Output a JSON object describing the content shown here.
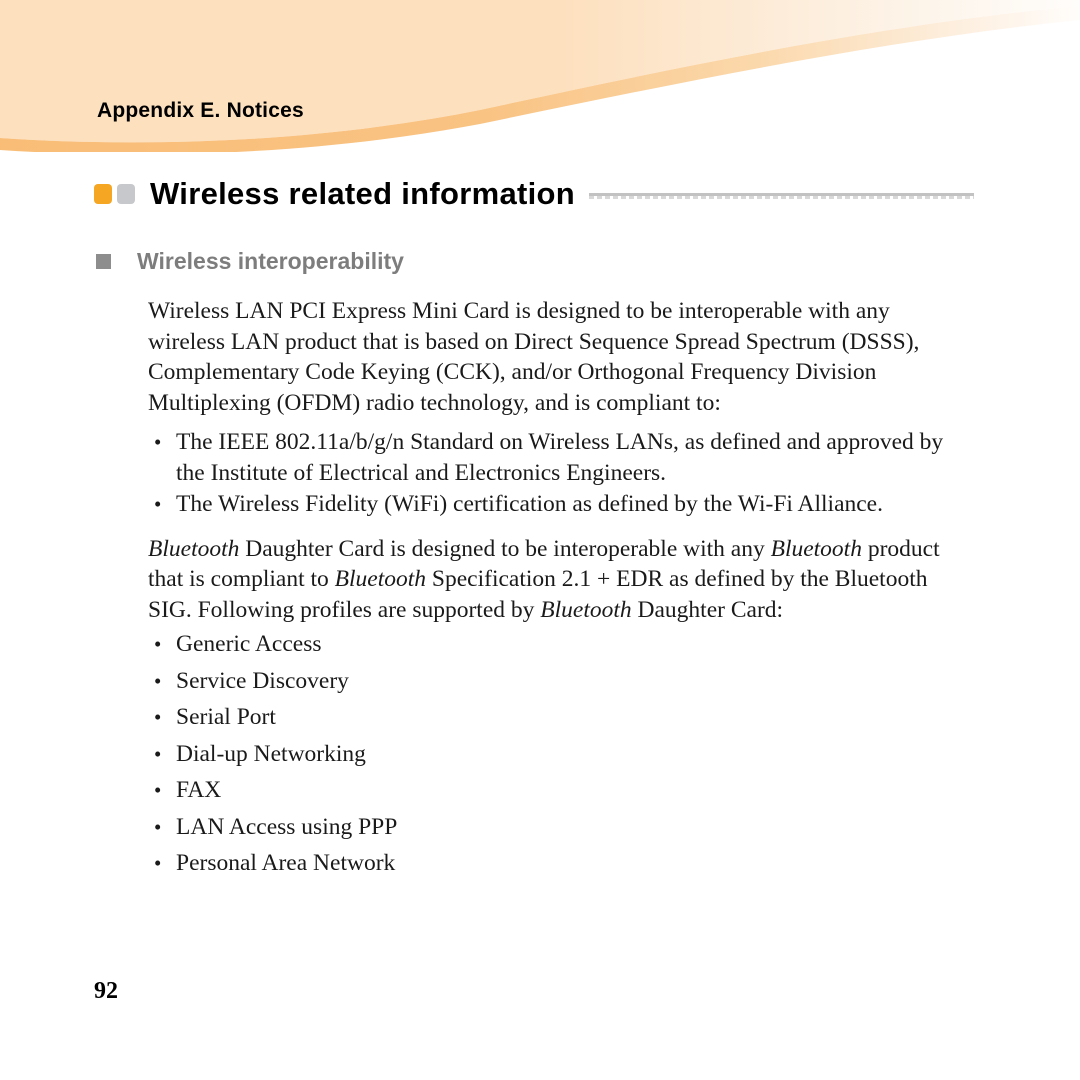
{
  "header": {
    "title": "Appendix E. Notices",
    "band_color_top": "#fde0be",
    "band_color_stripe": "#f9bd77"
  },
  "heading": {
    "h1": "Wireless related information",
    "square_orange": "#f5a623",
    "square_gray": "#c6c8cb",
    "rule_color": "#c2c2c2"
  },
  "subheading": {
    "h2": "Wireless interoperability",
    "bullet_color": "#8d8d8d",
    "text_color": "#7d7d7d"
  },
  "body": {
    "intro_paragraph": "Wireless LAN PCI Express Mini Card is designed to be interoperable with any wireless LAN product that is based on Direct Sequence Spread Spectrum (DSSS), Complementary Code Keying (CCK), and/or Orthogonal Frequency Division Multiplexing (OFDM) radio technology, and is compliant to:",
    "standards_bullets": [
      "The IEEE 802.11a/b/g/n Standard on Wireless LANs, as defined and approved by the Institute of Electrical and Electronics Engineers.",
      "The Wireless Fidelity (WiFi) certification as defined by the Wi-Fi Alliance."
    ],
    "bluetooth_paragraph_parts": [
      {
        "text": "Bluetooth",
        "italic": true
      },
      {
        "text": " Daughter Card is designed to be interoperable with any ",
        "italic": false
      },
      {
        "text": "Bluetooth",
        "italic": true
      },
      {
        "text": " product that is compliant to ",
        "italic": false
      },
      {
        "text": "Bluetooth",
        "italic": true
      },
      {
        "text": " Specification 2.1 + EDR as defined by the Bluetooth SIG. Following profiles are supported by ",
        "italic": false
      },
      {
        "text": "Bluetooth",
        "italic": true
      },
      {
        "text": " Daughter Card:",
        "italic": false
      }
    ],
    "profile_bullets": [
      "Generic Access",
      "Service Discovery",
      "Serial Port",
      "Dial-up Networking",
      "FAX",
      "LAN Access using PPP",
      "Personal Area Network"
    ]
  },
  "footer": {
    "page_number": "92"
  }
}
